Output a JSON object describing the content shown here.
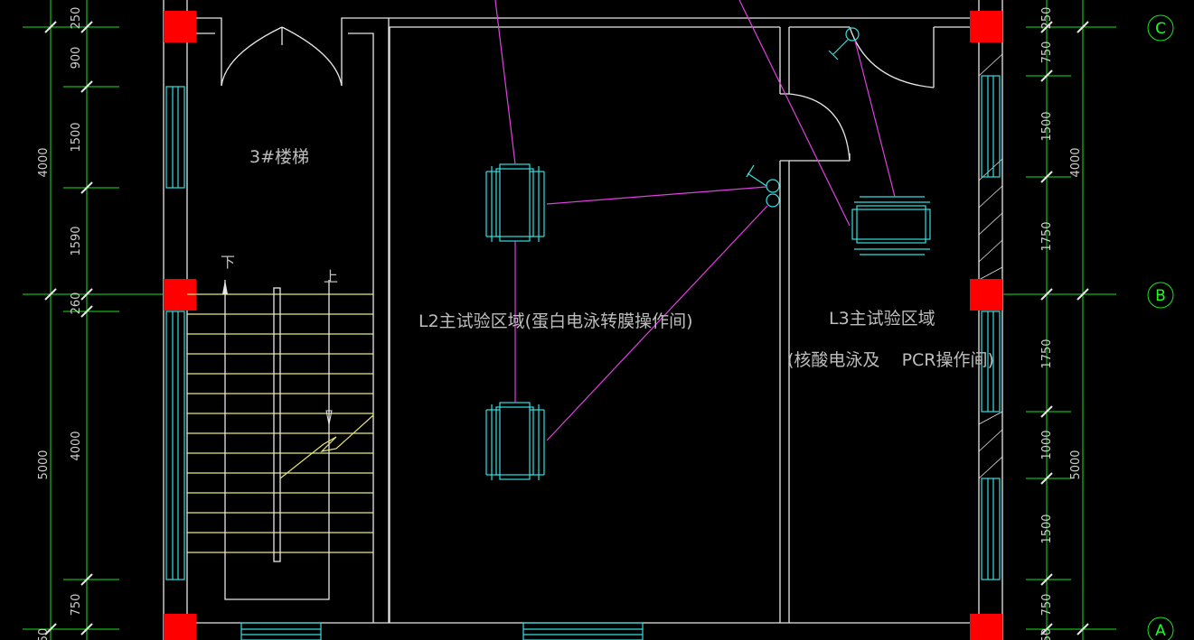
{
  "rooms": {
    "stair": "3#楼梯",
    "l2_label": "L2主试验区域(蛋白电泳转膜操作间)",
    "l3_label_line1": "L3主试验区域",
    "l3_label_line2": "(核酸电泳及    PCR操作间)",
    "stair_down": "下",
    "stair_up": "上"
  },
  "left_dims": {
    "outer": [
      "4000",
      "5000"
    ],
    "inner": [
      "250",
      "900",
      "1500",
      "1590",
      "260",
      "4000",
      "750",
      "50"
    ]
  },
  "right_dims": {
    "outer": [
      "4000",
      "5000"
    ],
    "inner": [
      "250",
      "750",
      "1500",
      "1750",
      "1750",
      "1000",
      "1500",
      "750",
      "50"
    ]
  },
  "axes": [
    "C",
    "B",
    "A"
  ],
  "colors": {
    "dimension": "#19e619",
    "wall": "#e6e6e6",
    "equipment": "#33e0e0",
    "stair_tread": "#e8e87a",
    "wiring": "#e040e0",
    "column": "#ff0000"
  }
}
